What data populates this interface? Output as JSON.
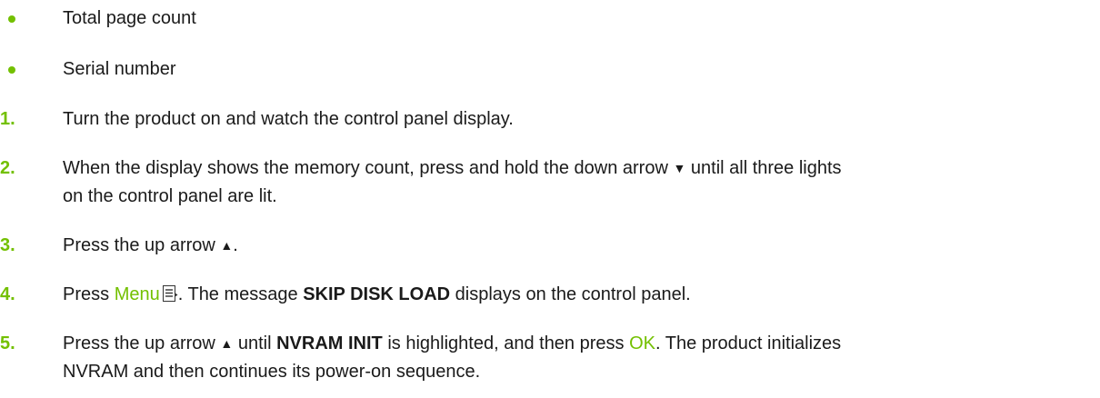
{
  "bullets": [
    {
      "text": "Total page count"
    },
    {
      "text": "Serial number"
    }
  ],
  "steps": [
    {
      "number": "1.",
      "text": "Turn the product on and watch the control panel display."
    },
    {
      "number": "2.",
      "line1_before": "When the display shows the memory count, press and hold the down arrow",
      "arrow": "▼",
      "line1_after": "until all three lights",
      "line2": "on the control panel are lit."
    },
    {
      "number": "3.",
      "before": "Press the up arrow",
      "arrow": "▲",
      "after": "."
    },
    {
      "number": "4.",
      "press": "Press",
      "menu": "Menu",
      "icon": "menu-icon",
      "after_icon": ". The message",
      "message": "SKIP DISK LOAD",
      "after_message": "displays on the control panel."
    },
    {
      "number": "5.",
      "before": "Press the up arrow",
      "arrow": "▲",
      "until": "until",
      "item": "NVRAM INIT",
      "middle": "is highlighted, and then press",
      "ok": "OK",
      "line1_end": ". The product initializes",
      "line2": "NVRAM and then continues its power-on sequence."
    }
  ],
  "accent_color": "#73c000"
}
